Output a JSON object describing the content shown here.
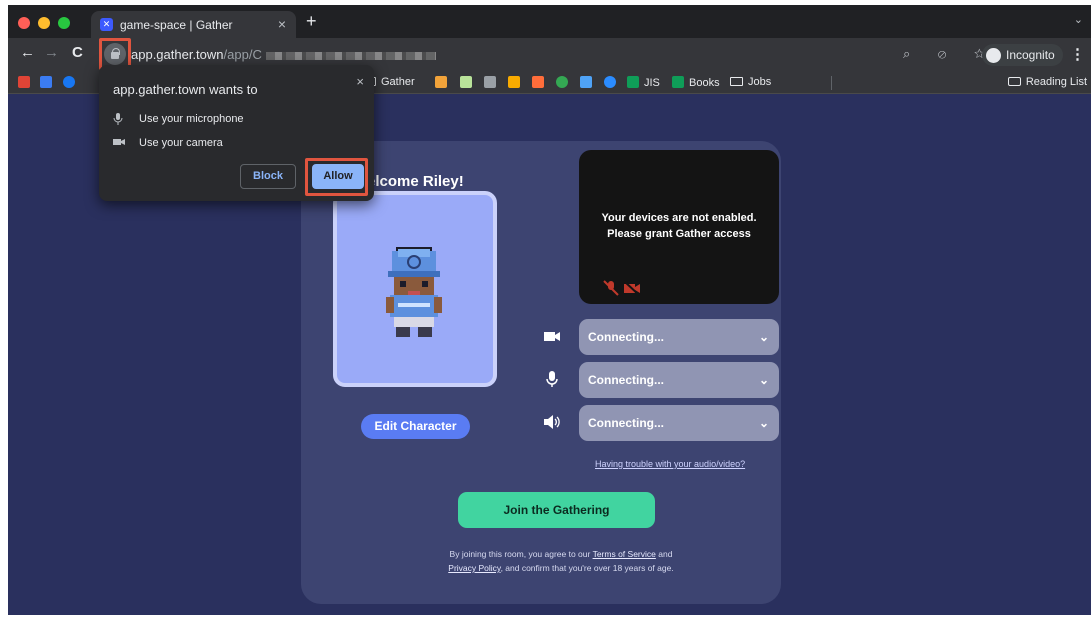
{
  "browser": {
    "tab_title": "game-space | Gather",
    "tab_close": "×",
    "new_tab": "+",
    "tabs_menu": "⌄",
    "back": "←",
    "forward": "→",
    "reload": "C",
    "url_host": "app.gather.town",
    "url_path": "/app/C",
    "toolbar_icons": "⌕ ⊘ ☆",
    "incognito_label": "Incognito",
    "menu": "⋮",
    "bookmarks": [
      "Gather",
      "JIS",
      "Books",
      "Jobs"
    ],
    "bookmark_icon_colors": [
      "#e04436",
      "#3b7cf2",
      "#1877f2",
      "#f2a33a",
      "#b9e39a",
      "#9aa0a6",
      "#f9ab00",
      "#ff6d3a",
      "#34a853",
      "#4fa3f7",
      "#2b8cff",
      "#0f9d58",
      "#0f9d58"
    ],
    "reading_list": "Reading List"
  },
  "permission_popup": {
    "title": "app.gather.town wants to",
    "close": "×",
    "permissions": [
      "Use your microphone",
      "Use your camera"
    ],
    "block": "Block",
    "allow": "Allow"
  },
  "gather": {
    "welcome": "elcome Riley!",
    "edit_character": "Edit Character",
    "video_message_line1": "Your devices are not enabled.",
    "video_message_line2": "Please grant Gather access",
    "devices": [
      "Connecting...",
      "Connecting...",
      "Connecting..."
    ],
    "trouble_link": "Having trouble with your audio/video?",
    "join_button": "Join the Gathering",
    "terms_pre": "By joining this room, you agree to our",
    "terms_link": "Terms of Service",
    "terms_and": "and",
    "privacy_link": "Privacy Policy",
    "terms_post": ", and confirm that you're over 18 years of age."
  },
  "colors": {
    "page_bg": "#2a305e",
    "card_bg": "#3d4471",
    "join": "#41d4a0",
    "edit": "#5a7cf3",
    "highlight": "#e0553f"
  }
}
